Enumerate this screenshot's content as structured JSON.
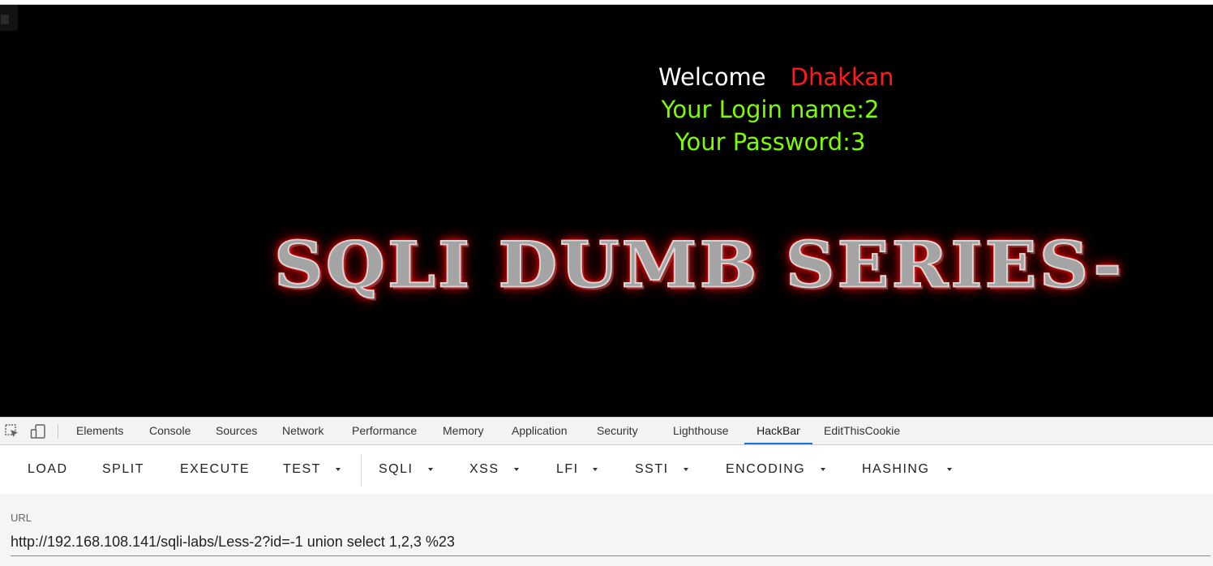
{
  "page": {
    "welcome_word": "Welcome",
    "welcome_name": "Dhakkan",
    "login_name_line": "Your Login name:2",
    "password_line": "Your Password:3",
    "banner_text": "SQLI DUMB SERIES-",
    "colors": {
      "background": "#000000",
      "welcome": "#ffffff",
      "name": "#ff1a1a",
      "info": "#7cfc00",
      "banner_glow": "#ff0000"
    }
  },
  "devtools": {
    "icons": [
      "inspect-element-icon",
      "device-toolbar-icon"
    ],
    "tabs": [
      {
        "label": "Elements"
      },
      {
        "label": "Console"
      },
      {
        "label": "Sources"
      },
      {
        "label": "Network"
      },
      {
        "label": "Performance"
      },
      {
        "label": "Memory"
      },
      {
        "label": "Application"
      },
      {
        "label": "Security"
      },
      {
        "label": "Lighthouse"
      },
      {
        "label": "HackBar",
        "active": true
      },
      {
        "label": "EditThisCookie"
      }
    ],
    "accent": "#1a73e8"
  },
  "hackbar": {
    "buttons": [
      {
        "label": "LOAD"
      },
      {
        "label": "SPLIT"
      },
      {
        "label": "EXECUTE"
      },
      {
        "label": "TEST",
        "dropdown": true
      },
      {
        "label": "SQLI",
        "dropdown": true
      },
      {
        "label": "XSS",
        "dropdown": true
      },
      {
        "label": "LFI",
        "dropdown": true
      },
      {
        "label": "SSTI",
        "dropdown": true
      },
      {
        "label": "ENCODING",
        "dropdown": true
      },
      {
        "label": "HASHING",
        "dropdown": true
      }
    ],
    "url_label": "URL",
    "url_value": "http://192.168.108.141/sqli-labs/Less-2?id=-1 union select 1,2,3 %23"
  }
}
